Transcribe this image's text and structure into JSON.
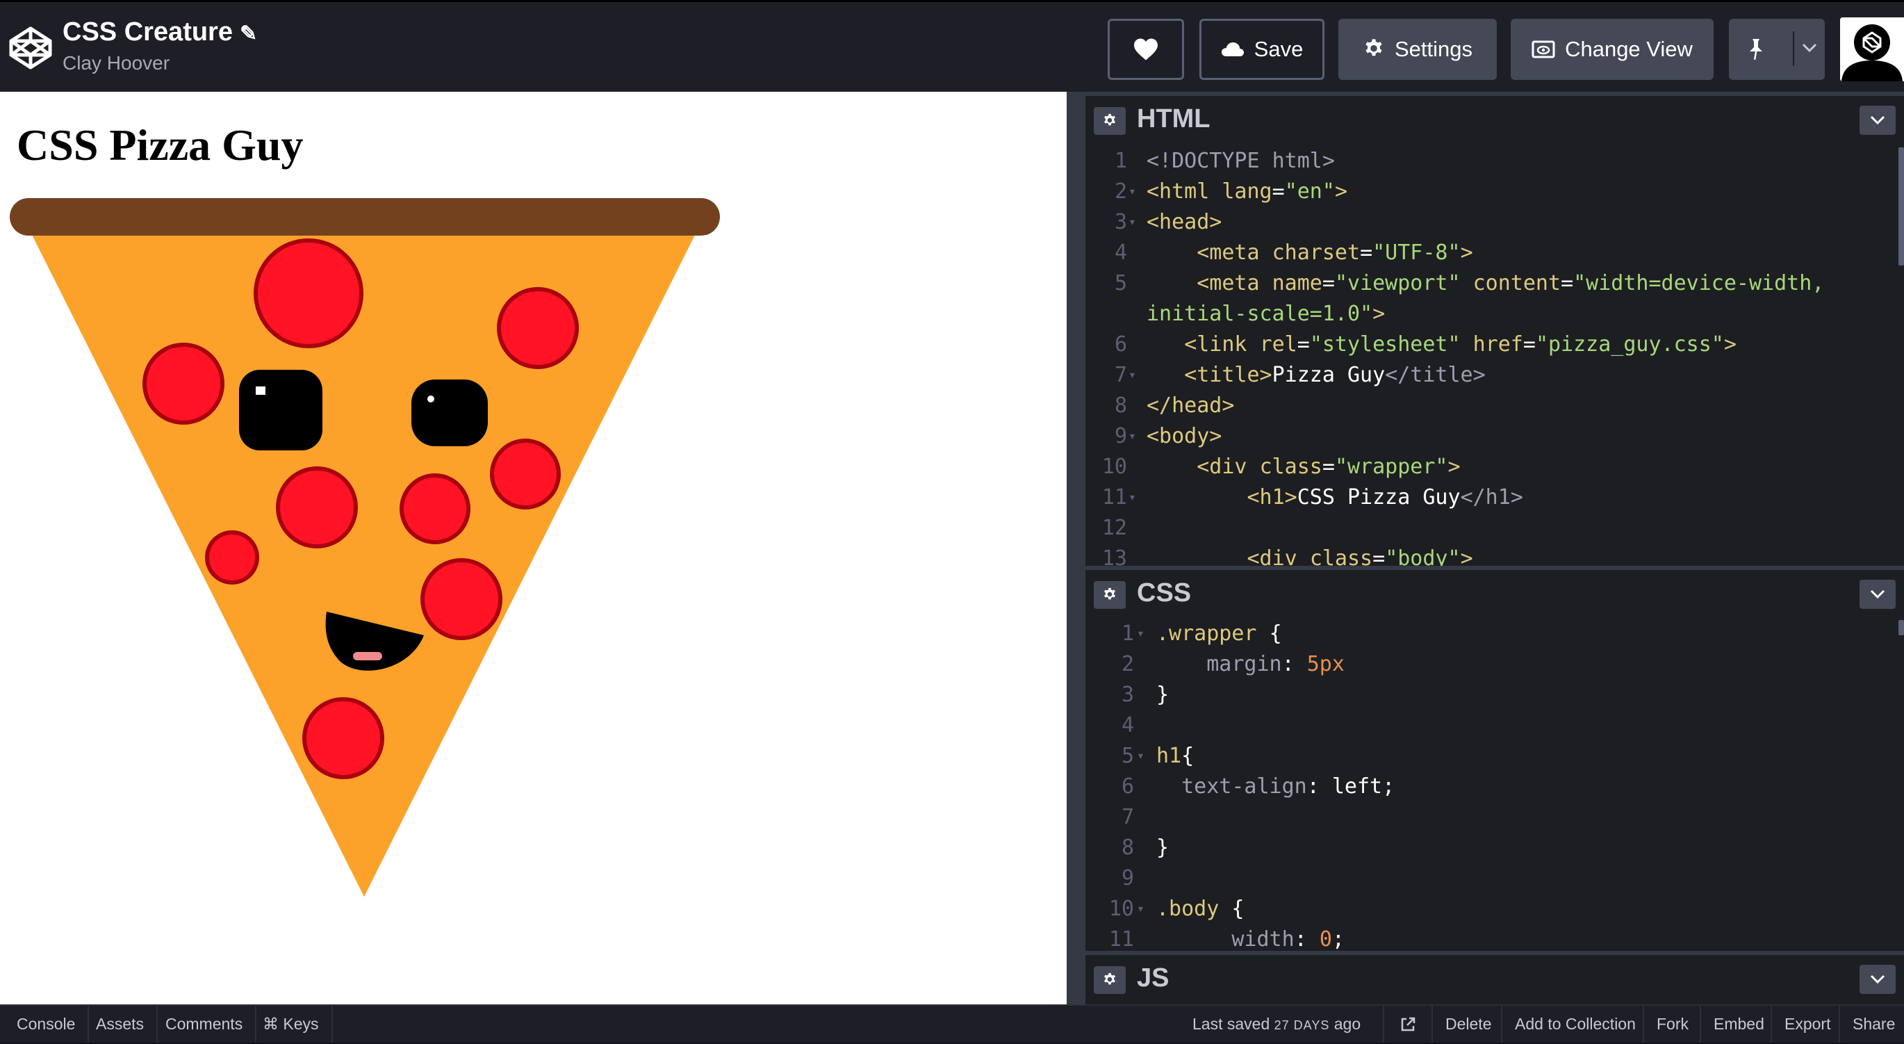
{
  "header": {
    "pen_title": "CSS Creature",
    "author": "Clay Hoover",
    "buttons": {
      "like_icon": "heart-icon",
      "save_label": "Save",
      "settings_label": "Settings",
      "change_view_label": "Change View",
      "pin_icon": "pin-icon"
    }
  },
  "preview": {
    "heading": "CSS Pizza Guy"
  },
  "editors": {
    "html": {
      "label": "HTML",
      "lines": [
        {
          "n": "1",
          "fold": false,
          "indent": 0,
          "parts": [
            {
              "c": "t-ang",
              "t": "<!DOCTYPE html>"
            }
          ]
        },
        {
          "n": "2",
          "fold": true,
          "indent": 0,
          "parts": [
            {
              "c": "t-tag",
              "t": "<html "
            },
            {
              "c": "t-attr",
              "t": "lang"
            },
            {
              "c": "t-plain",
              "t": "="
            },
            {
              "c": "t-val",
              "t": "\"en\""
            },
            {
              "c": "t-tag",
              "t": ">"
            }
          ]
        },
        {
          "n": "3",
          "fold": true,
          "indent": 0,
          "parts": [
            {
              "c": "t-tag",
              "t": "<head>"
            }
          ]
        },
        {
          "n": "4",
          "fold": false,
          "indent": 4,
          "parts": [
            {
              "c": "t-tag",
              "t": "<meta "
            },
            {
              "c": "t-attr",
              "t": "charset"
            },
            {
              "c": "t-plain",
              "t": "="
            },
            {
              "c": "t-val",
              "t": "\"UTF-8\""
            },
            {
              "c": "t-tag",
              "t": ">"
            }
          ]
        },
        {
          "n": "5",
          "fold": false,
          "indent": 4,
          "parts": [
            {
              "c": "t-tag",
              "t": "<meta "
            },
            {
              "c": "t-attr",
              "t": "name"
            },
            {
              "c": "t-plain",
              "t": "="
            },
            {
              "c": "t-val",
              "t": "\"viewport\" "
            },
            {
              "c": "t-attr",
              "t": "content"
            },
            {
              "c": "t-plain",
              "t": "="
            },
            {
              "c": "t-val",
              "t": "\"width=device-width,"
            }
          ]
        },
        {
          "n": "",
          "fold": false,
          "indent": 0,
          "parts": [
            {
              "c": "t-val",
              "t": "initial-scale=1.0\""
            },
            {
              "c": "t-tag",
              "t": ">"
            }
          ]
        },
        {
          "n": "6",
          "fold": false,
          "indent": 3,
          "parts": [
            {
              "c": "t-tag",
              "t": "<link "
            },
            {
              "c": "t-attr",
              "t": "rel"
            },
            {
              "c": "t-plain",
              "t": "="
            },
            {
              "c": "t-val",
              "t": "\"stylesheet\" "
            },
            {
              "c": "t-attr",
              "t": "href"
            },
            {
              "c": "t-plain",
              "t": "="
            },
            {
              "c": "t-val",
              "t": "\"pizza_guy.css\""
            },
            {
              "c": "t-tag",
              "t": ">"
            }
          ]
        },
        {
          "n": "7",
          "fold": true,
          "indent": 3,
          "parts": [
            {
              "c": "t-tag",
              "t": "<title>"
            },
            {
              "c": "t-plain",
              "t": "Pizza Guy"
            },
            {
              "c": "t-ang",
              "t": "</title>"
            }
          ]
        },
        {
          "n": "8",
          "fold": false,
          "indent": 0,
          "parts": [
            {
              "c": "t-tag",
              "t": "</head>"
            }
          ]
        },
        {
          "n": "9",
          "fold": true,
          "indent": 0,
          "parts": [
            {
              "c": "t-tag",
              "t": "<body>"
            }
          ]
        },
        {
          "n": "10",
          "fold": false,
          "indent": 4,
          "parts": [
            {
              "c": "t-tag",
              "t": "<div "
            },
            {
              "c": "t-attr",
              "t": "class"
            },
            {
              "c": "t-plain",
              "t": "="
            },
            {
              "c": "t-val",
              "t": "\"wrapper\""
            },
            {
              "c": "t-tag",
              "t": ">"
            }
          ]
        },
        {
          "n": "11",
          "fold": true,
          "indent": 8,
          "parts": [
            {
              "c": "t-tag",
              "t": "<h1>"
            },
            {
              "c": "t-plain",
              "t": "CSS Pizza Guy"
            },
            {
              "c": "t-ang",
              "t": "</h1>"
            }
          ]
        },
        {
          "n": "12",
          "fold": false,
          "indent": 0,
          "parts": []
        },
        {
          "n": "13",
          "fold": false,
          "indent": 8,
          "parts": [
            {
              "c": "t-tag",
              "t": "<div "
            },
            {
              "c": "t-attr",
              "t": "class"
            },
            {
              "c": "t-plain",
              "t": "="
            },
            {
              "c": "t-val",
              "t": "\"body\""
            },
            {
              "c": "t-tag",
              "t": ">"
            }
          ]
        }
      ]
    },
    "css": {
      "label": "CSS",
      "lines": [
        {
          "n": "1",
          "fold": true,
          "indent": 0,
          "parts": [
            {
              "c": "t-sel",
              "t": ".wrapper "
            },
            {
              "c": "t-plain",
              "t": "{"
            }
          ]
        },
        {
          "n": "2",
          "fold": false,
          "indent": 4,
          "parts": [
            {
              "c": "t-prop",
              "t": "margin"
            },
            {
              "c": "t-plain",
              "t": ": "
            },
            {
              "c": "t-num",
              "t": "5px"
            }
          ]
        },
        {
          "n": "3",
          "fold": false,
          "indent": 0,
          "parts": [
            {
              "c": "t-plain",
              "t": "}"
            }
          ]
        },
        {
          "n": "4",
          "fold": false,
          "indent": 0,
          "parts": []
        },
        {
          "n": "5",
          "fold": true,
          "indent": 0,
          "parts": [
            {
              "c": "t-sel",
              "t": "h1"
            },
            {
              "c": "t-plain",
              "t": "{"
            }
          ]
        },
        {
          "n": "6",
          "fold": false,
          "indent": 2,
          "parts": [
            {
              "c": "t-prop",
              "t": "text-align"
            },
            {
              "c": "t-plain",
              "t": ": left;"
            }
          ]
        },
        {
          "n": "7",
          "fold": false,
          "indent": 0,
          "parts": []
        },
        {
          "n": "8",
          "fold": false,
          "indent": 0,
          "parts": [
            {
              "c": "t-plain",
              "t": "}"
            }
          ]
        },
        {
          "n": "9",
          "fold": false,
          "indent": 0,
          "parts": []
        },
        {
          "n": "10",
          "fold": true,
          "indent": 0,
          "parts": [
            {
              "c": "t-sel",
              "t": ".body "
            },
            {
              "c": "t-plain",
              "t": "{"
            }
          ]
        },
        {
          "n": "11",
          "fold": false,
          "indent": 6,
          "parts": [
            {
              "c": "t-prop",
              "t": "width"
            },
            {
              "c": "t-plain",
              "t": ": "
            },
            {
              "c": "t-num",
              "t": "0"
            },
            {
              "c": "t-plain",
              "t": ";"
            }
          ]
        }
      ]
    },
    "js": {
      "label": "JS"
    }
  },
  "footer": {
    "console": "Console",
    "assets": "Assets",
    "comments": "Comments",
    "keys": "⌘ Keys",
    "last_saved_prefix": "Last saved ",
    "last_saved_days": "27 DAYS",
    "last_saved_suffix": " ago",
    "delete": "Delete",
    "add_to_collection": "Add to Collection",
    "fork": "Fork",
    "embed": "Embed",
    "export": "Export",
    "share": "Share"
  },
  "colors": {
    "crust": "#74411f",
    "cheese": "#fca12a",
    "pepperoni": "#ff1325",
    "pepperoni_edge": "#a8000f",
    "header_bg": "#1e1f26",
    "editor_bg": "#1d1e22"
  }
}
